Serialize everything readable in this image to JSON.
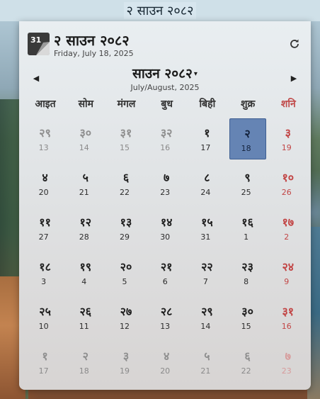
{
  "panel": {
    "label": "२ साउन २०८२"
  },
  "header": {
    "icon_text": "31",
    "title": "२ साउन २०८२",
    "subtitle": "Friday, July 18, 2025"
  },
  "nav": {
    "prev": "◀",
    "next": "▶",
    "month_title": "साउन २०८२",
    "caret": "▾",
    "month_sub": "July/August, 2025"
  },
  "weekdays": [
    "आइत",
    "सोम",
    "मंगल",
    "बुध",
    "बिही",
    "शुक्र",
    "शनि"
  ],
  "weeks": [
    [
      {
        "ne": "२९",
        "en": "13",
        "other": true
      },
      {
        "ne": "३०",
        "en": "14",
        "other": true
      },
      {
        "ne": "३१",
        "en": "15",
        "other": true
      },
      {
        "ne": "३२",
        "en": "16",
        "other": true
      },
      {
        "ne": "१",
        "en": "17"
      },
      {
        "ne": "२",
        "en": "18",
        "today": true
      },
      {
        "ne": "३",
        "en": "19"
      }
    ],
    [
      {
        "ne": "४",
        "en": "20"
      },
      {
        "ne": "५",
        "en": "21"
      },
      {
        "ne": "६",
        "en": "22"
      },
      {
        "ne": "७",
        "en": "23"
      },
      {
        "ne": "८",
        "en": "24"
      },
      {
        "ne": "९",
        "en": "25"
      },
      {
        "ne": "१०",
        "en": "26"
      }
    ],
    [
      {
        "ne": "११",
        "en": "27"
      },
      {
        "ne": "१२",
        "en": "28"
      },
      {
        "ne": "१३",
        "en": "29"
      },
      {
        "ne": "१४",
        "en": "30"
      },
      {
        "ne": "१५",
        "en": "31"
      },
      {
        "ne": "१६",
        "en": "1"
      },
      {
        "ne": "१७",
        "en": "2"
      }
    ],
    [
      {
        "ne": "१८",
        "en": "3"
      },
      {
        "ne": "१९",
        "en": "4"
      },
      {
        "ne": "२०",
        "en": "5"
      },
      {
        "ne": "२१",
        "en": "6"
      },
      {
        "ne": "२२",
        "en": "7"
      },
      {
        "ne": "२३",
        "en": "8"
      },
      {
        "ne": "२४",
        "en": "9"
      }
    ],
    [
      {
        "ne": "२५",
        "en": "10"
      },
      {
        "ne": "२६",
        "en": "11"
      },
      {
        "ne": "२७",
        "en": "12"
      },
      {
        "ne": "२८",
        "en": "13"
      },
      {
        "ne": "२९",
        "en": "14"
      },
      {
        "ne": "३०",
        "en": "15"
      },
      {
        "ne": "३१",
        "en": "16"
      }
    ],
    [
      {
        "ne": "१",
        "en": "17",
        "other": true
      },
      {
        "ne": "२",
        "en": "18",
        "other": true
      },
      {
        "ne": "३",
        "en": "19",
        "other": true
      },
      {
        "ne": "४",
        "en": "20",
        "other": true
      },
      {
        "ne": "५",
        "en": "21",
        "other": true
      },
      {
        "ne": "६",
        "en": "22",
        "other": true
      },
      {
        "ne": "७",
        "en": "23",
        "other": true
      }
    ]
  ],
  "colors": {
    "saturday": "#c24646",
    "today_bg": "#6584b4",
    "icon_dark": "#3a3a3a"
  },
  "icons": {
    "refresh": "refresh-icon",
    "app": "calendar-app-icon"
  }
}
